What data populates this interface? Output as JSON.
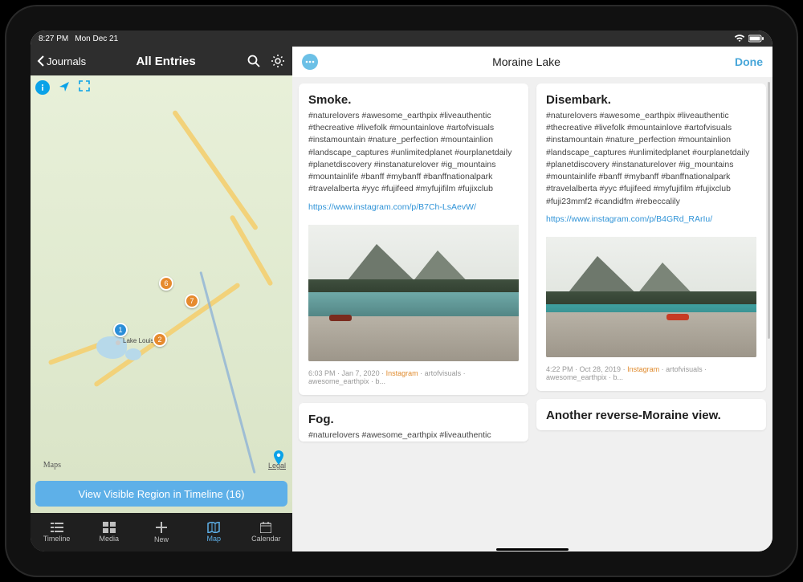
{
  "status": {
    "time": "8:27 PM",
    "date": "Mon Dec 21"
  },
  "left": {
    "back_label": "Journals",
    "title": "All Entries",
    "map": {
      "brand": "Maps",
      "legal": "Legal",
      "town": "Lake Louise",
      "pins": {
        "p1": "1",
        "p2": "2",
        "p3": "7",
        "p4": "6"
      }
    },
    "region_button": "View Visible Region in Timeline (16)"
  },
  "tabs": {
    "timeline": "Timeline",
    "media": "Media",
    "new": "New",
    "map": "Map",
    "calendar": "Calendar"
  },
  "right": {
    "title": "Moraine Lake",
    "done": "Done"
  },
  "cards": {
    "smoke": {
      "title": "Smoke.",
      "tags": "#naturelovers #awesome_earthpix #liveauthentic #thecreative #livefolk #mountainlove #artofvisuals #instamountain #nature_perfection #mountainlion #landscape_captures #unlimitedplanet #ourplanetdaily #planetdiscovery #instanaturelover #ig_mountains #mountainlife  #banff #mybanff #banffnationalpark #travelalberta #yyc #fujifeed #myfujifilm #fujixclub",
      "link": "https://www.instagram.com/p/B7Ch-LsAevW/",
      "meta_time": "6:03 PM",
      "meta_date": "Jan 7, 2020",
      "meta_source": "Instagram",
      "meta_tags": "artofvisuals · awesome_earthpix · b..."
    },
    "disembark": {
      "title": "Disembark.",
      "tags": "#naturelovers #awesome_earthpix #liveauthentic #thecreative #livefolk #mountainlove #artofvisuals #instamountain #nature_perfection #mountainlion #landscape_captures #unlimitedplanet #ourplanetdaily #planetdiscovery #instanaturelover #ig_mountains #mountainlife  #banff #mybanff #banffnationalpark #travelalberta #yyc #fujifeed #myfujifilm #fujixclub #fuji23mmf2 #candidfm #rebeccalily",
      "link": "https://www.instagram.com/p/B4GRd_RArIu/",
      "meta_time": "4:22 PM",
      "meta_date": "Oct 28, 2019",
      "meta_source": "Instagram",
      "meta_tags": "artofvisuals · awesome_earthpix · b..."
    },
    "fog": {
      "title": "Fog.",
      "tags": "#naturelovers #awesome_earthpix #liveauthentic"
    },
    "another": {
      "title": "Another reverse-Moraine view."
    }
  }
}
